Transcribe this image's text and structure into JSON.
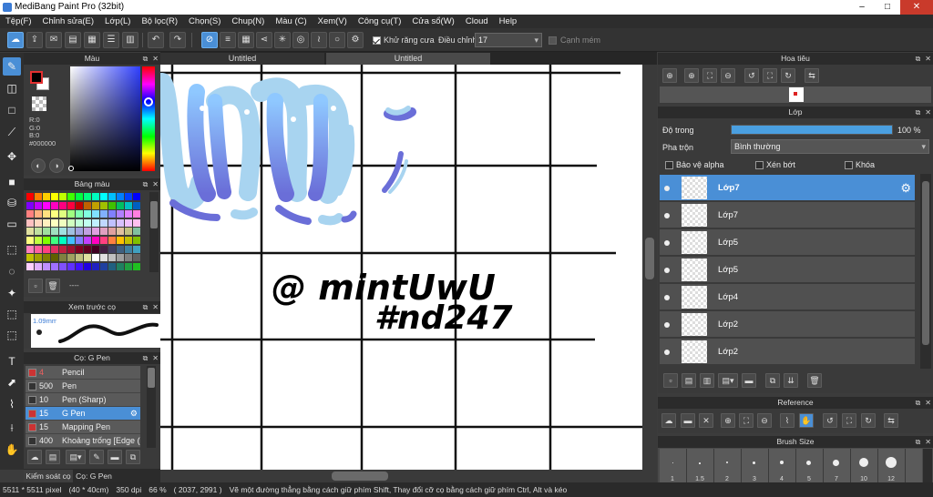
{
  "app": {
    "title": "MediBang Paint Pro (32bit)"
  },
  "window_controls": {
    "minimize": "–",
    "maximize": "□",
    "close": "✕"
  },
  "menu": [
    "Tệp(F)",
    "Chỉnh sửa(E)",
    "Lớp(L)",
    "Bộ lọc(R)",
    "Chọn(S)",
    "Chup(N)",
    "Màu (C)",
    "Xem(V)",
    "Công cụ(T)",
    "Cửa sổ(W)",
    "Cloud",
    "Help"
  ],
  "toolbar": {
    "antialias_label": "Khử răng cưa",
    "antialias_checked": true,
    "adjust_label": "Điều chỉnh",
    "adjust_value": "17",
    "sharp_label": "Cạnh mém",
    "sharp_checked": false
  },
  "color_panel": {
    "title": "Màu",
    "r": "R:0",
    "g": "G:0",
    "b": "B:0",
    "hex": "#000000",
    "foreground": "#000000",
    "background": "#ffffff",
    "accent": "#e23030"
  },
  "palette_panel": {
    "title": "Bảng màu",
    "footer": "----",
    "rows": [
      [
        "#ff0000",
        "#ff8000",
        "#ffd000",
        "#ffff00",
        "#c0ff00",
        "#40ff00",
        "#00ff40",
        "#00ff80",
        "#00ffc0",
        "#00ffff",
        "#00c0ff",
        "#0080ff",
        "#0040ff",
        "#0000ff"
      ],
      [
        "#8000ff",
        "#c000ff",
        "#ff00ff",
        "#ff00c0",
        "#ff0080",
        "#ff0040",
        "#c00000",
        "#c06000",
        "#c0a000",
        "#a0c000",
        "#40c000",
        "#00c060",
        "#00c0c0",
        "#0060c0"
      ],
      [
        "#ff8080",
        "#ffb080",
        "#ffe080",
        "#ffff80",
        "#e0ff80",
        "#a0ff80",
        "#80ffb0",
        "#80ffe0",
        "#80e0ff",
        "#80b0ff",
        "#8080ff",
        "#b080ff",
        "#e080ff",
        "#ff80e0"
      ],
      [
        "#ffc0c0",
        "#ffd8c0",
        "#fff0c0",
        "#ffffc0",
        "#f0ffc0",
        "#d0ffc0",
        "#c0ffd8",
        "#c0fff0",
        "#c0f0ff",
        "#c0d8ff",
        "#c0c0ff",
        "#d8c0ff",
        "#f0c0ff",
        "#ffc0f0"
      ],
      [
        "#e0e0a0",
        "#c0e0a0",
        "#a0e0a0",
        "#a0e0c0",
        "#a0e0e0",
        "#a0c0e0",
        "#a0a0e0",
        "#c0a0e0",
        "#e0a0e0",
        "#e0a0c0",
        "#e0a0a0",
        "#e0c0a0",
        "#c0c080",
        "#80c0a0"
      ],
      [
        "#ffff80",
        "#c0ff40",
        "#80ff00",
        "#40ff80",
        "#00ffc0",
        "#40c0ff",
        "#8080ff",
        "#c040ff",
        "#ff00c0",
        "#ff4080",
        "#ff8040",
        "#ffc000",
        "#c0c000",
        "#80c000"
      ],
      [
        "#ff80c0",
        "#ff60a0",
        "#ff4080",
        "#e03060",
        "#c02040",
        "#a01030",
        "#800020",
        "#600020",
        "#400020",
        "#402040",
        "#404060",
        "#406080",
        "#4080a0",
        "#40a0c0"
      ],
      [
        "#c0c000",
        "#a0a000",
        "#808000",
        "#606000",
        "#808040",
        "#a0a060",
        "#c0c080",
        "#e0e0a0",
        "#ffffff",
        "#e0e0e0",
        "#c0c0c0",
        "#a0a0a0",
        "#808080",
        "#606060"
      ],
      [
        "#ffd0ff",
        "#e0b0ff",
        "#c090ff",
        "#a070ff",
        "#8050ff",
        "#6030ff",
        "#4010ff",
        "#2000e0",
        "#2020c0",
        "#2040a0",
        "#206080",
        "#208060",
        "#20a040",
        "#20c020"
      ]
    ]
  },
  "brush_preview_panel": {
    "title": "Xem trước cọ",
    "size": "1.09mm"
  },
  "brush_panel": {
    "title": "Cọ: G Pen",
    "items": [
      {
        "size": "4",
        "name": "Pencil",
        "color": "#cc3333"
      },
      {
        "size": "500",
        "name": "Pen",
        "color": "#333333"
      },
      {
        "size": "10",
        "name": "Pen (Sharp)",
        "color": "#333333"
      },
      {
        "size": "15",
        "name": "G Pen",
        "color": "#cc3333"
      },
      {
        "size": "15",
        "name": "Mapping Pen",
        "color": "#cc3333"
      },
      {
        "size": "400",
        "name": "Khoảng trống [Edge (",
        "color": "#333333"
      }
    ]
  },
  "left_bottom_tabs": [
    "Kiểm soát cọ",
    "Cọ: G Pen"
  ],
  "canvas": {
    "tabs": [
      "Untitled",
      "Untitled"
    ],
    "text_line1": "@ mintUwU",
    "text_line2": "#nd247"
  },
  "navigator_panel": {
    "title": "Hoa tiêu"
  },
  "layer_panel": {
    "title": "Lớp",
    "opacity_label": "Độ trong",
    "opacity_value": "100 %",
    "opacity_fraction": 1.0,
    "blend_label": "Pha trộn",
    "blend_value": "Bình thường",
    "protect_alpha": "Bảo vệ alpha",
    "clipping": "Xén bớt",
    "lock": "Khóa",
    "layers": [
      "Lớp7",
      "Lớp7",
      "Lớp5",
      "Lớp5",
      "Lớp4",
      "Lớp2",
      "Lớp2"
    ]
  },
  "reference_panel": {
    "title": "Reference"
  },
  "brush_size_panel": {
    "title": "Brush Size",
    "sizes": [
      "1",
      "1.5",
      "2",
      "3",
      "4",
      "5",
      "7",
      "10",
      "12"
    ]
  },
  "status": {
    "canvas_size": "5511 * 5511 pixel",
    "physical_size": "(40 * 40cm)",
    "dpi": "350 dpi",
    "zoom": "66 %",
    "cursor": "( 2037, 2991 )",
    "hint": "Vẽ một đường thẳng bằng cách giữ phím Shift, Thay đổi cỡ cọ bằng cách giữ phím Ctrl, Alt và kéo"
  }
}
